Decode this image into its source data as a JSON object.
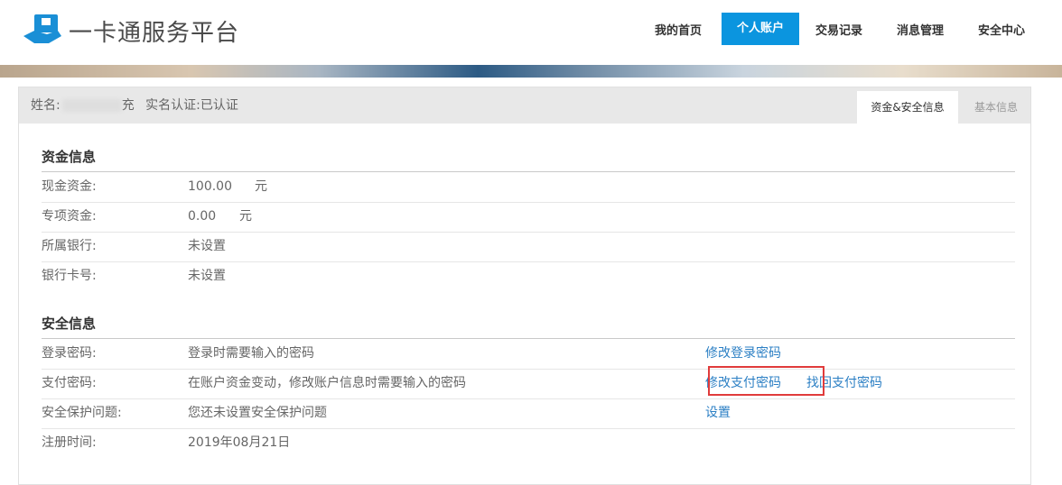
{
  "header": {
    "brand": "一卡通服务平台",
    "nav": [
      {
        "label": "我的首页",
        "active": false
      },
      {
        "label": "个人账户",
        "active": true
      },
      {
        "label": "交易记录",
        "active": false
      },
      {
        "label": "消息管理",
        "active": false
      },
      {
        "label": "安全中心",
        "active": false
      }
    ],
    "accent_color": "#0b95df"
  },
  "profile": {
    "name_label": "姓名:",
    "name_suffix": "充",
    "verify_text": "实名认证:已认证",
    "tabs": [
      {
        "label": "资金&安全信息",
        "active": true
      },
      {
        "label": "基本信息",
        "active": false
      }
    ]
  },
  "funds": {
    "title": "资金信息",
    "rows": [
      {
        "label": "现金资金:",
        "value": "100.00",
        "unit": "元"
      },
      {
        "label": "专项资金:",
        "value": "0.00",
        "unit": "元"
      },
      {
        "label": "所属银行:",
        "value": "未设置"
      },
      {
        "label": "银行卡号:",
        "value": "未设置"
      }
    ]
  },
  "security": {
    "title": "安全信息",
    "rows": [
      {
        "label": "登录密码:",
        "value": "登录时需要输入的密码",
        "action": "修改登录密码"
      },
      {
        "label": "支付密码:",
        "value": "在账户资金变动，修改账户信息时需要输入的密码",
        "action": "修改支付密码",
        "action2": "找回支付密码"
      },
      {
        "label": "安全保护问题:",
        "value": "您还未设置安全保护问题",
        "action": "设置"
      },
      {
        "label": "注册时间:",
        "value": "2019年08月21日"
      }
    ]
  }
}
